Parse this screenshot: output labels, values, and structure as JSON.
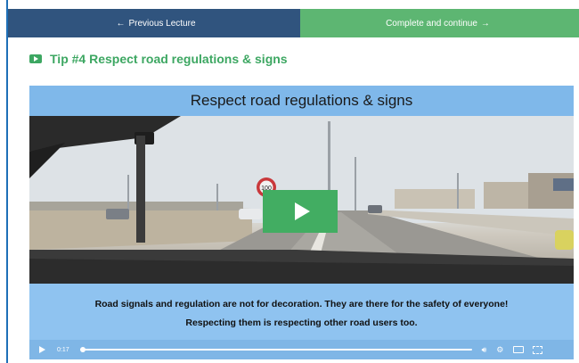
{
  "nav": {
    "prev_label": "Previous Lecture",
    "next_label": "Complete and continue",
    "prev_color": "#30547e",
    "next_color": "#5db672"
  },
  "lecture": {
    "icon": "youtube-play-icon",
    "title": "Tip #4 Respect road regulations & signs",
    "accent": "#3da762"
  },
  "video": {
    "slide_title": "Respect road regulations & signs",
    "caption_line1": "Road signals and regulation are not  for decoration. They are there for the safety of everyone!",
    "caption_line2": "Respecting them is respecting other road users too.",
    "road_sign_text": "100",
    "controls": {
      "time": "0:17",
      "progress": 0.0,
      "volume_icon": "speaker-icon",
      "settings_icon": "gear-icon",
      "cc_icon": "closed-captions-icon",
      "fullscreen_icon": "fullscreen-icon"
    }
  }
}
